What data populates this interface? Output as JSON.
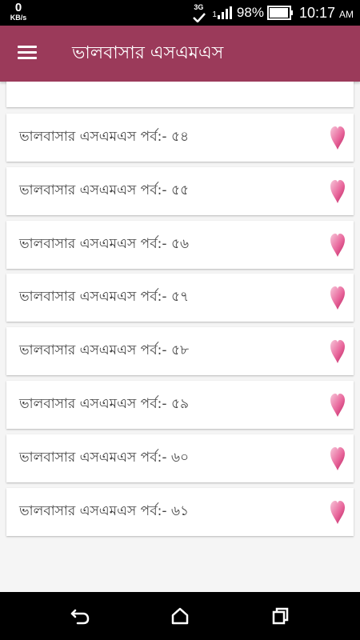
{
  "status_bar": {
    "speed_value": "0",
    "speed_unit": "KB/s",
    "network_type": "3G",
    "signal_prefix": "1",
    "battery_percent": "98%",
    "battery_level": 0.98,
    "time": "10:17",
    "ampm": "AM"
  },
  "app_bar": {
    "title": "ভালবাসার এসএমএস",
    "color": "#9b3a5a"
  },
  "list": {
    "items": [
      {
        "label": "ভালবাসার এসএমএস পর্ব:- ৫৪",
        "icon": "heart-icon"
      },
      {
        "label": "ভালবাসার এসএমএস পর্ব:- ৫৫",
        "icon": "heart-icon"
      },
      {
        "label": "ভালবাসার এসএমএস পর্ব:- ৫৬",
        "icon": "heart-icon"
      },
      {
        "label": "ভালবাসার এসএমএস পর্ব:- ৫৭",
        "icon": "heart-icon"
      },
      {
        "label": "ভালবাসার এসএমএস পর্ব:- ৫৮",
        "icon": "heart-icon"
      },
      {
        "label": "ভালবাসার এসএমএস পর্ব:- ৫৯",
        "icon": "heart-icon"
      },
      {
        "label": "ভালবাসার এসএমএস পর্ব:- ৬০",
        "icon": "heart-icon"
      },
      {
        "label": "ভালবাসার এসএমএস পর্ব:- ৬১",
        "icon": "heart-icon"
      }
    ]
  },
  "nav_bar": {
    "buttons": [
      "back-icon",
      "home-icon",
      "recents-icon"
    ]
  }
}
